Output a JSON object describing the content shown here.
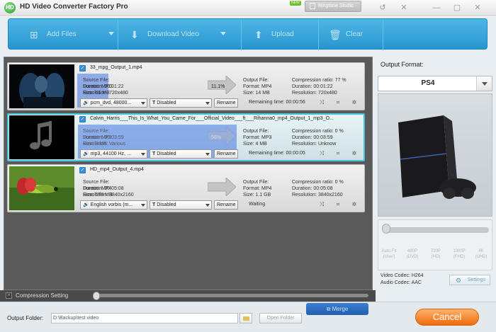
{
  "app": {
    "title": "HD Video Converter Factory Pro",
    "badge": "NEW",
    "ringtone": "Ringtone Studio"
  },
  "toolbar": {
    "add_files": "Add Files",
    "download_video": "Download Video",
    "upload": "Upload",
    "clear": "Clear"
  },
  "items": [
    {
      "filename": "33_mpg_Output_1.mp4",
      "source_label": "Source File:",
      "format": "Format: MPG",
      "size": "Size: 61 MB",
      "duration": "Duration: 00:01:22",
      "resolution": "Resolution: 720x480",
      "progress": "11.1%",
      "out_label": "Output File:",
      "out_format": "Format: MP4",
      "out_size": "Size: 14 MB",
      "ratio": "Compression ratio: 77 %",
      "out_duration": "Duration: 00:01:22",
      "out_resolution": "Resolution: 720x480",
      "audio": "pcm_dvd, 48000...",
      "subtitle": "Disabled",
      "rename": "Rename",
      "status": "Remaining time: 00:00:56"
    },
    {
      "filename": "Calvin_Harris___This_Is_What_You_Came_For___Official_Video___ft___Rihanna0_mp4_Output_1_mp3_O...",
      "source_label": "Source File:",
      "format": "Format: MP3",
      "size": "Size: 3 MB",
      "duration": "Duration: 00:03:59",
      "resolution": "Resolution: Various",
      "progress": "56%",
      "out_label": "Output File:",
      "out_format": "Format: MP3",
      "out_size": "Size: 4 MB",
      "ratio": "Compression ratio: 0 %",
      "out_duration": "Duration: 00:03:59",
      "out_resolution": "Resolution: Unknow",
      "audio": "mp3, 44100 Hz, ...",
      "subtitle": "Disabled",
      "rename": "Rename",
      "status": "Remaining time: 00:00:05"
    },
    {
      "filename": "HD_mp4_Output_4.mp4",
      "source_label": "Source File:",
      "format": "Format: MP4",
      "size": "Size: 578 MB",
      "duration": "Duration: 00:05:08",
      "resolution": "Resolution: 3840x2160",
      "progress": "",
      "out_label": "Output File:",
      "out_format": "Format: MP4",
      "out_size": "Size: 1.1 GB",
      "ratio": "Compression ratio: 0 %",
      "out_duration": "Duration: 00:05:08",
      "out_resolution": "Resolution: 3840x2160",
      "audio": "English vorbis (m...",
      "subtitle": "Disabled",
      "rename": "Rename",
      "status": "Waiting"
    }
  ],
  "progress_values": [
    0.11,
    0.56,
    0
  ],
  "right": {
    "output_format_label": "Output Format:",
    "format": "PS4",
    "quality": [
      {
        "a": "Auto Fit",
        "b": "(User)"
      },
      {
        "a": "480P",
        "b": "(DVD)"
      },
      {
        "a": "720P",
        "b": "(HD)"
      },
      {
        "a": "1080P",
        "b": "(FHD)"
      },
      {
        "a": "4K",
        "b": "(UHD)"
      }
    ],
    "video_codec": "Video Codec: H264",
    "audio_codec": "Audio Codec: AAC",
    "settings": "Settings"
  },
  "compression": {
    "label": "Compression Setting"
  },
  "bottom": {
    "output_folder_label": "Output Folder:",
    "path": "D:\\Backup\\test video",
    "open_folder": "Open Folder",
    "merge": "Merge",
    "cancel": "Cancel"
  }
}
